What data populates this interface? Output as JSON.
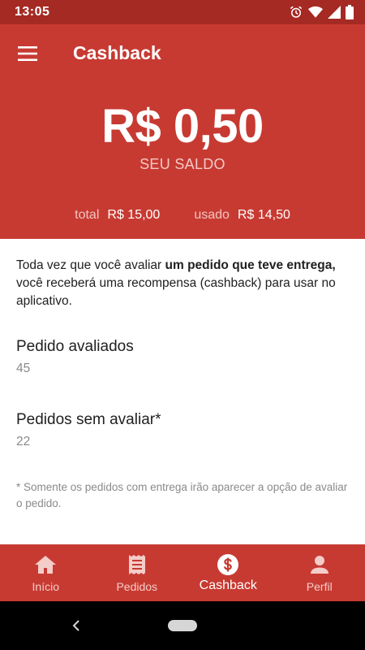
{
  "status_bar": {
    "time": "13:05",
    "icons": [
      "alarm-icon",
      "wifi-icon",
      "signal-icon",
      "battery-icon"
    ]
  },
  "app_bar": {
    "title": "Cashback",
    "menu_icon": "hamburger-menu-icon"
  },
  "balance": {
    "amount": "R$ 0,50",
    "caption": "SEU SALDO",
    "total_label": "total",
    "total_value": "R$ 15,00",
    "used_label": "usado",
    "used_value": "R$ 14,50"
  },
  "intro": {
    "text_before": "Toda vez que você avaliar ",
    "text_bold": "um pedido que teve entrega,",
    "text_after": " você receberá uma recompensa (cashback) para usar no aplicativo."
  },
  "stats": [
    {
      "label": "Pedido avaliados",
      "value": "45"
    },
    {
      "label": "Pedidos sem avaliar*",
      "value": "22"
    }
  ],
  "footnote": "* Somente os pedidos com entrega irão aparecer a opção de avaliar o pedido.",
  "bottom_nav": {
    "items": [
      {
        "label": "Início",
        "icon": "home-icon",
        "active": false
      },
      {
        "label": "Pedidos",
        "icon": "receipt-icon",
        "active": false
      },
      {
        "label": "Cashback",
        "icon": "dollar-circle-icon",
        "active": true
      },
      {
        "label": "Perfil",
        "icon": "person-icon",
        "active": false
      }
    ]
  },
  "colors": {
    "primary": "#c73a32",
    "status_bar": "#a52a24",
    "muted_text": "#8a8a8a"
  }
}
